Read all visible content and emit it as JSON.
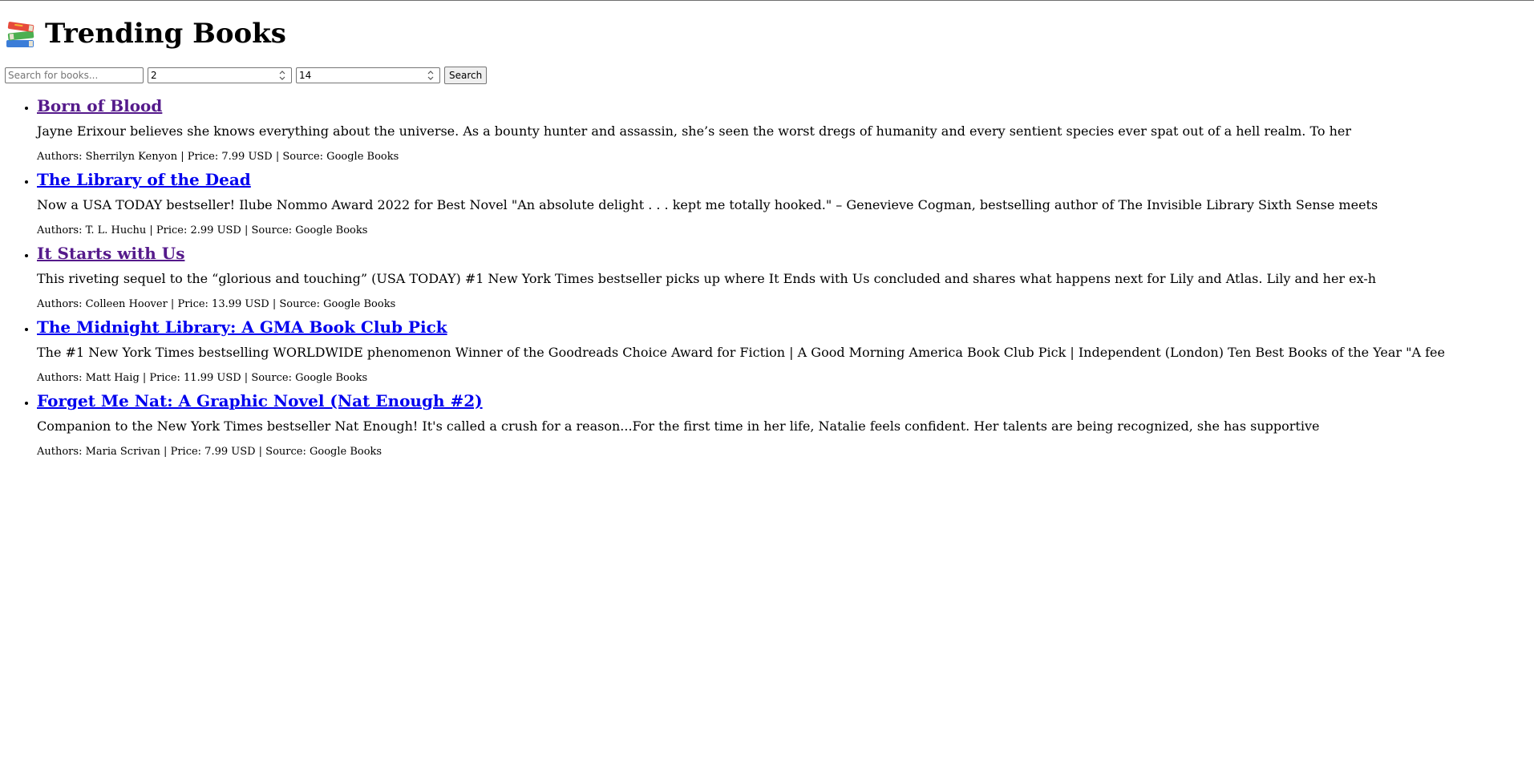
{
  "header": {
    "logo_icon": "books-stack-icon",
    "title": "Trending Books"
  },
  "search": {
    "query_placeholder": "Search for books...",
    "query_value": "",
    "number_1": "2",
    "number_2": "14",
    "button_label": "Search"
  },
  "books": [
    {
      "title": "Born of Blood",
      "visited": true,
      "description": "Jayne Erixour believes she knows everything about the universe. As a bounty hunter and assassin, she’s seen the worst dregs of humanity and every sentient species ever spat out of a hell realm. To her",
      "meta": "Authors: Sherrilyn Kenyon | Price: 7.99 USD | Source: Google Books"
    },
    {
      "title": "The Library of the Dead",
      "visited": false,
      "description": "Now a USA TODAY bestseller! Ilube Nommo Award 2022 for Best Novel \"An absolute delight . . . kept me totally hooked.\" – Genevieve Cogman, bestselling author of The Invisible Library Sixth Sense meets",
      "meta": "Authors: T. L. Huchu | Price: 2.99 USD | Source: Google Books"
    },
    {
      "title": "It Starts with Us",
      "visited": true,
      "description": "This riveting sequel to the “glorious and touching” (USA TODAY) #1 New York Times bestseller picks up where It Ends with Us concluded and shares what happens next for Lily and Atlas. Lily and her ex-h",
      "meta": "Authors: Colleen Hoover | Price: 13.99 USD | Source: Google Books"
    },
    {
      "title": "The Midnight Library: A GMA Book Club Pick",
      "visited": false,
      "description": "The #1 New York Times bestselling WORLDWIDE phenomenon Winner of the Goodreads Choice Award for Fiction | A Good Morning America Book Club Pick | Independent (London) Ten Best Books of the Year \"A fee",
      "meta": "Authors: Matt Haig | Price: 11.99 USD | Source: Google Books"
    },
    {
      "title": "Forget Me Nat: A Graphic Novel (Nat Enough #2)",
      "visited": false,
      "description": "Companion to the New York Times bestseller Nat Enough! It's called a crush for a reason...For the first time in her life, Natalie feels confident. Her talents are being recognized, she has supportive",
      "meta": "Authors: Maria Scrivan | Price: 7.99 USD | Source: Google Books"
    }
  ],
  "colors": {
    "link_visited": "#551a8b",
    "link_unvisited": "#0000ee"
  }
}
